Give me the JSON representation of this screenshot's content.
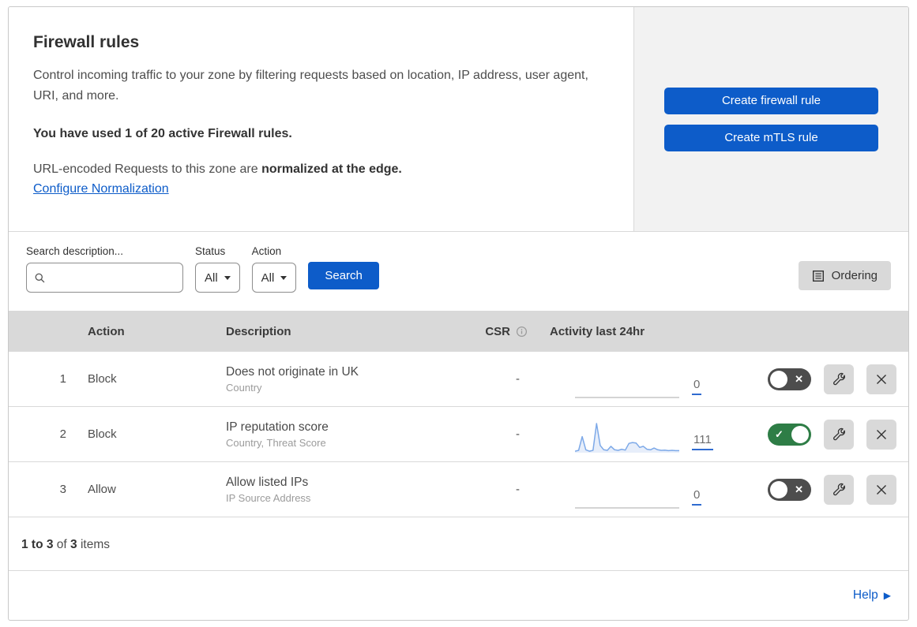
{
  "header": {
    "title": "Firewall rules",
    "description": "Control incoming traffic to your zone by filtering requests based on location, IP address, user agent, URI, and more.",
    "usage_notice": "You have used 1 of 20 active Firewall rules.",
    "normalization_text": "URL-encoded Requests to this zone are ",
    "normalization_bold": "normalized at the edge.",
    "configure_link": "Configure Normalization"
  },
  "actions_panel": {
    "create_firewall_rule": "Create firewall rule",
    "create_mtls_rule": "Create mTLS rule"
  },
  "filters": {
    "search_label": "Search description...",
    "search_value": "",
    "status_label": "Status",
    "status_value": "All",
    "action_label": "Action",
    "action_value": "All",
    "search_button": "Search",
    "ordering_button": "Ordering"
  },
  "table": {
    "headers": {
      "action": "Action",
      "description": "Description",
      "csr": "CSR",
      "activity": "Activity last 24hr"
    },
    "rows": [
      {
        "priority": "1",
        "action": "Block",
        "description": "Does not originate in UK",
        "fields": "Country",
        "csr": "-",
        "activity_count": "0",
        "enabled": false,
        "spark": []
      },
      {
        "priority": "2",
        "action": "Block",
        "description": "IP reputation score",
        "fields": "Country, Threat Score",
        "csr": "-",
        "activity_count": "111",
        "enabled": true,
        "spark": [
          5,
          8,
          55,
          10,
          5,
          8,
          100,
          25,
          10,
          8,
          22,
          10,
          8,
          12,
          9,
          32,
          35,
          33,
          18,
          22,
          12,
          10,
          16,
          10,
          8,
          9,
          7,
          8,
          7,
          7
        ]
      },
      {
        "priority": "3",
        "action": "Allow",
        "description": "Allow listed IPs",
        "fields": "IP Source Address",
        "csr": "-",
        "activity_count": "0",
        "enabled": false,
        "spark": []
      }
    ]
  },
  "footer": {
    "range": "1 to 3",
    "of": "of",
    "total": "3",
    "items_label": "items",
    "help": "Help"
  },
  "colors": {
    "accent_blue": "#0d5cc9",
    "toggle_on_green": "#2e7d46",
    "toggle_off_gray": "#4d4d4d",
    "sparkline_blue": "#7da9e8",
    "panel_gray": "#f2f2f2",
    "table_header_gray": "#d9d9d9"
  }
}
